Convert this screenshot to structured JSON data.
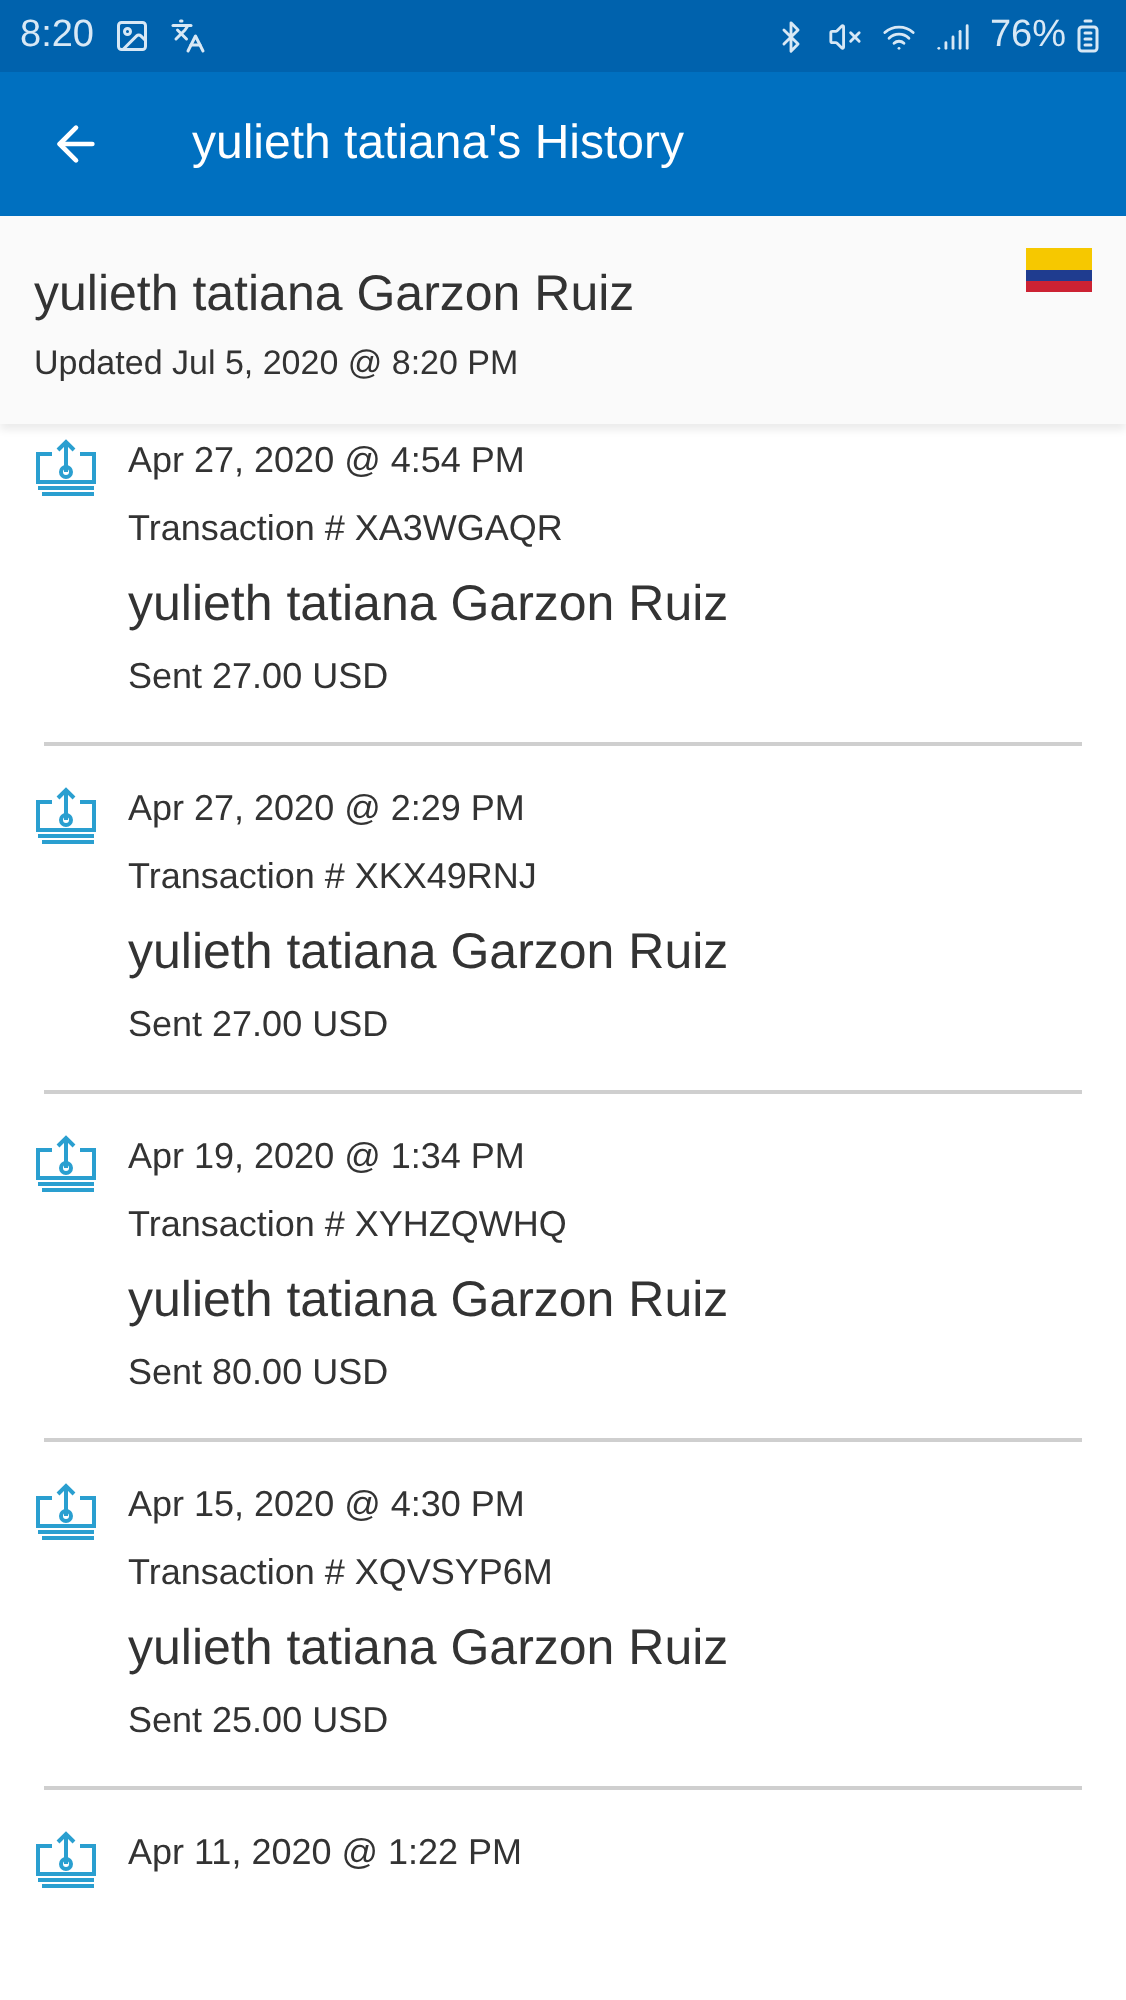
{
  "status_bar": {
    "time": "8:20",
    "battery": "76%"
  },
  "app_bar": {
    "title": "yulieth tatiana's History"
  },
  "contact": {
    "name": "yulieth tatiana Garzon Ruiz",
    "updated": "Updated Jul 5, 2020 @ 8:20 PM"
  },
  "transactions": [
    {
      "date": "Apr 27, 2020 @ 4:54 PM",
      "transaction": "Transaction # XA3WGAQR",
      "recipient": "yulieth tatiana Garzon Ruiz",
      "amount": "Sent 27.00 USD"
    },
    {
      "date": "Apr 27, 2020 @ 2:29 PM",
      "transaction": "Transaction # XKX49RNJ",
      "recipient": "yulieth tatiana Garzon Ruiz",
      "amount": "Sent 27.00 USD"
    },
    {
      "date": "Apr 19, 2020 @ 1:34 PM",
      "transaction": "Transaction # XYHZQWHQ",
      "recipient": "yulieth tatiana Garzon Ruiz",
      "amount": "Sent 80.00 USD"
    },
    {
      "date": "Apr 15, 2020 @ 4:30 PM",
      "transaction": "Transaction # XQVSYP6M",
      "recipient": "yulieth tatiana Garzon Ruiz",
      "amount": "Sent 25.00 USD"
    },
    {
      "date": "Apr 11, 2020 @ 1:22 PM"
    }
  ]
}
